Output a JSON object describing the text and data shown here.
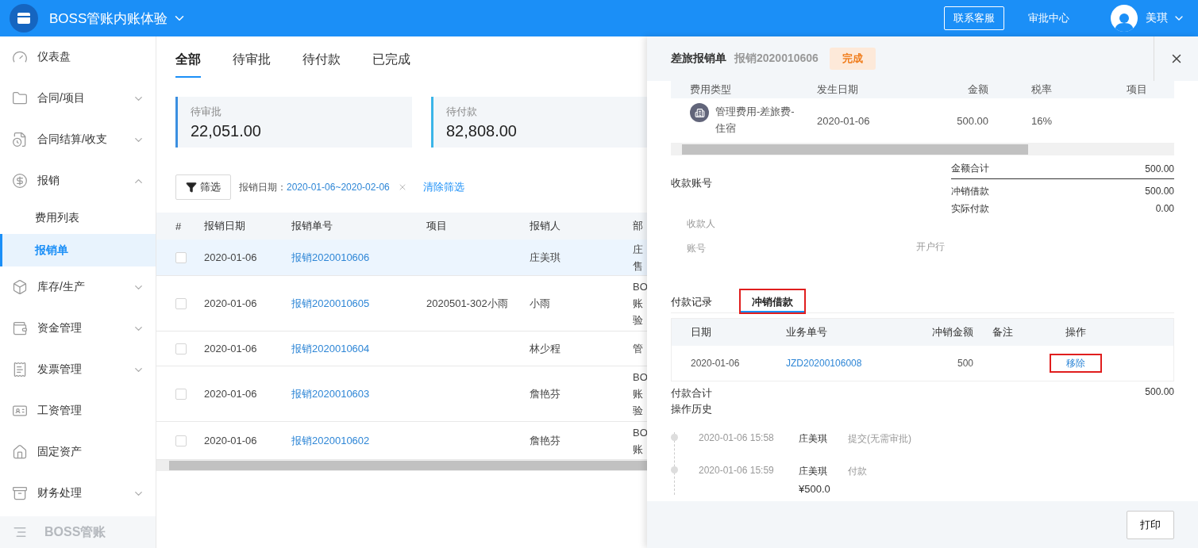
{
  "topbar": {
    "title": "BOSS管账内账体验",
    "service_button": "联系客服",
    "approval_link": "审批中心",
    "user": "美琪"
  },
  "sidebar": {
    "items": [
      {
        "label": "仪表盘"
      },
      {
        "label": "合同/项目",
        "expanded": false
      },
      {
        "label": "合同结算/收支",
        "expanded": false
      },
      {
        "label": "报销",
        "expanded": true,
        "children": [
          {
            "label": "费用列表",
            "selected": false
          },
          {
            "label": "报销单",
            "selected": true
          }
        ]
      },
      {
        "label": "库存/生产",
        "expanded": false
      },
      {
        "label": "资金管理",
        "expanded": false
      },
      {
        "label": "发票管理",
        "expanded": false
      },
      {
        "label": "工资管理"
      },
      {
        "label": "固定资产"
      },
      {
        "label": "财务处理",
        "expanded": false
      }
    ],
    "footer": "BOSS管账"
  },
  "tabs": [
    {
      "label": "全部",
      "selected": true
    },
    {
      "label": "待审批",
      "selected": false
    },
    {
      "label": "待付款",
      "selected": false
    },
    {
      "label": "已完成",
      "selected": false
    }
  ],
  "stats": [
    {
      "label": "待审批",
      "value": "22,051.00",
      "color": "#3b8fe0"
    },
    {
      "label": "待付款",
      "value": "82,808.00",
      "color": "#3bb5e8"
    }
  ],
  "filter": {
    "button": "筛选",
    "tag_label": "报销日期：",
    "tag_value": "2020-01-06~2020-02-06",
    "clear": "清除筛选"
  },
  "table": {
    "columns": [
      "#",
      "报销日期",
      "报销单号",
      "项目",
      "报销人",
      "部"
    ],
    "rows": [
      {
        "date": "2020-01-06",
        "number": "报销2020010606",
        "project": "",
        "person": "庄美琪",
        "dept": [
          "庄",
          "售"
        ],
        "checked": false,
        "selected": true
      },
      {
        "date": "2020-01-06",
        "number": "报销2020010605",
        "project": "2020501-302小雨",
        "person": "小雨",
        "dept": [
          "BO",
          "账",
          "验"
        ],
        "checked": false,
        "selected": false
      },
      {
        "date": "2020-01-06",
        "number": "报销2020010604",
        "project": "",
        "person": "林少程",
        "dept": [
          "管"
        ],
        "checked": false,
        "selected": false
      },
      {
        "date": "2020-01-06",
        "number": "报销2020010603",
        "project": "",
        "person": "詹艳芬",
        "dept": [
          "BO",
          "账",
          "验"
        ],
        "checked": false,
        "selected": false
      },
      {
        "date": "2020-01-06",
        "number": "报销2020010602",
        "project": "",
        "person": "詹艳芬",
        "dept": [
          "BO",
          "账"
        ],
        "checked": false,
        "selected": false
      }
    ]
  },
  "drawer": {
    "title": "差旅报销单",
    "number": "报销2020010606",
    "status": "完成",
    "detail_columns": [
      "费用类型",
      "发生日期",
      "金额",
      "税率",
      "项目"
    ],
    "detail_rows": [
      {
        "type": "管理费用-差旅费-住宿",
        "date": "2020-01-06",
        "amount": "500.00",
        "tax": "16%"
      }
    ],
    "account_title": "收款账号",
    "payee_label": "收款人",
    "account_label": "账号",
    "bank_label": "开户行",
    "totals": [
      {
        "label": "金额合计",
        "value": "500.00"
      },
      {
        "label": "冲销借款",
        "value": "500.00"
      },
      {
        "label": "实际付款",
        "value": "0.00"
      }
    ],
    "subtabs": [
      {
        "label": "付款记录",
        "selected": false,
        "highlighted": false
      },
      {
        "label": "冲销借款",
        "selected": true,
        "highlighted": true
      }
    ],
    "offset_columns": [
      "日期",
      "业务单号",
      "冲销金额",
      "备注",
      "操作"
    ],
    "offset_rows": [
      {
        "date": "2020-01-06",
        "number": "JZD20200106008",
        "amount": "500",
        "note": "",
        "action": "移除",
        "action_highlighted": true
      }
    ],
    "payment_total_label": "付款合计",
    "payment_total": "500.00",
    "history_title": "操作历史",
    "history": [
      {
        "time": "2020-01-06 15:58",
        "user": "庄美琪",
        "action": "提交(无需审批)"
      },
      {
        "time": "2020-01-06 15:59",
        "user": "庄美琪",
        "action": "付款",
        "amount": "¥500.0"
      }
    ],
    "print": "打印"
  }
}
